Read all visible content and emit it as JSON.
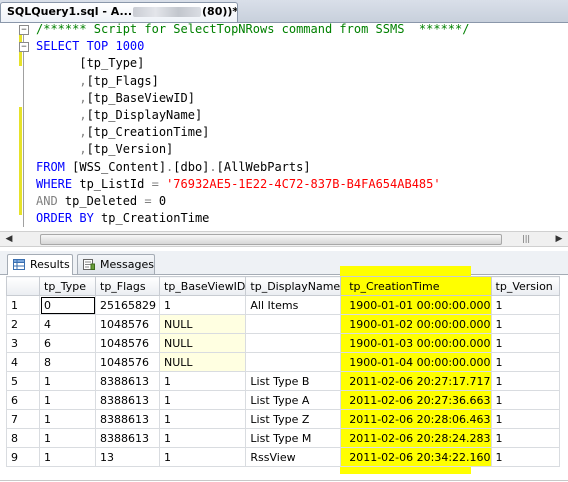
{
  "tab": {
    "title_prefix": "SQLQuery1.sql - A...",
    "title_suffix": "(80))*"
  },
  "editor": {
    "lines": [
      [
        {
          "t": "/****** Script for SelectTopNRows command from SSMS  ******/",
          "c": "comment"
        }
      ],
      [
        {
          "t": "SELECT TOP 1000",
          "c": "kw"
        }
      ],
      [
        {
          "t": "      [tp_Type]",
          "c": "plain"
        }
      ],
      [
        {
          "t": "      ,",
          "c": "gray"
        },
        {
          "t": "[tp_Flags]",
          "c": "plain"
        }
      ],
      [
        {
          "t": "      ,",
          "c": "gray"
        },
        {
          "t": "[tp_BaseViewID]",
          "c": "plain"
        }
      ],
      [
        {
          "t": "      ,",
          "c": "gray"
        },
        {
          "t": "[tp_DisplayName]",
          "c": "plain"
        }
      ],
      [
        {
          "t": "      ,",
          "c": "gray"
        },
        {
          "t": "[tp_CreationTime]",
          "c": "plain"
        }
      ],
      [
        {
          "t": "      ,",
          "c": "gray"
        },
        {
          "t": "[tp_Version]",
          "c": "plain"
        }
      ],
      [
        {
          "t": "FROM ",
          "c": "kw"
        },
        {
          "t": "[WSS_Content]",
          "c": "plain"
        },
        {
          "t": ".",
          "c": "gray"
        },
        {
          "t": "[dbo]",
          "c": "plain"
        },
        {
          "t": ".",
          "c": "gray"
        },
        {
          "t": "[AllWebParts]",
          "c": "plain"
        }
      ],
      [
        {
          "t": "WHERE ",
          "c": "kw"
        },
        {
          "t": "tp_ListId ",
          "c": "plain"
        },
        {
          "t": "= ",
          "c": "gray"
        },
        {
          "t": "'76932AE5-1E22-4C72-837B-B4FA654AB485'",
          "c": "str"
        }
      ],
      [
        {
          "t": "AND ",
          "c": "gray"
        },
        {
          "t": "tp_Deleted ",
          "c": "plain"
        },
        {
          "t": "= ",
          "c": "gray"
        },
        {
          "t": "0",
          "c": "plain"
        }
      ],
      [
        {
          "t": "ORDER BY ",
          "c": "kw"
        },
        {
          "t": "tp_CreationTime",
          "c": "plain"
        }
      ]
    ]
  },
  "results_tabs": {
    "results_label": "Results",
    "messages_label": "Messages"
  },
  "grid": {
    "columns": [
      "tp_Type",
      "tp_Flags",
      "tp_BaseViewID",
      "tp_DisplayName",
      "tp_CreationTime",
      "tp_Version"
    ],
    "rows": [
      [
        "1",
        "0",
        "25165829",
        "1",
        "All Items",
        "1900-01-01 00:00:00.000",
        "1"
      ],
      [
        "2",
        "4",
        "1048576",
        "NULL",
        "",
        "1900-01-02 00:00:00.000",
        "1"
      ],
      [
        "3",
        "6",
        "1048576",
        "NULL",
        "",
        "1900-01-03 00:00:00.000",
        "1"
      ],
      [
        "4",
        "8",
        "1048576",
        "NULL",
        "",
        "1900-01-04 00:00:00.000",
        "1"
      ],
      [
        "5",
        "1",
        "8388613",
        "1",
        "List Type B",
        "2011-02-06 20:27:17.717",
        "1"
      ],
      [
        "6",
        "1",
        "8388613",
        "1",
        "List Type A",
        "2011-02-06 20:27:36.663",
        "1"
      ],
      [
        "7",
        "1",
        "8388613",
        "1",
        "List Type Z",
        "2011-02-06 20:28:06.463",
        "1"
      ],
      [
        "8",
        "1",
        "8388613",
        "1",
        "List Type M",
        "2011-02-06 20:28:24.283",
        "1"
      ],
      [
        "9",
        "1",
        "13",
        "1",
        "RssView",
        "2011-02-06 20:34:22.160",
        "1"
      ]
    ],
    "null_value": "NULL"
  },
  "colors": {
    "keyword": "#0000ff",
    "comment": "#008000",
    "string": "#ff0000",
    "operator": "#808080",
    "highlight": "#ffff00",
    "null_cell": "#ffffe1"
  },
  "icons": {
    "results_tab": "grid-icon",
    "messages_tab": "messages-icon",
    "collapse": "collapse-minus-icon"
  }
}
